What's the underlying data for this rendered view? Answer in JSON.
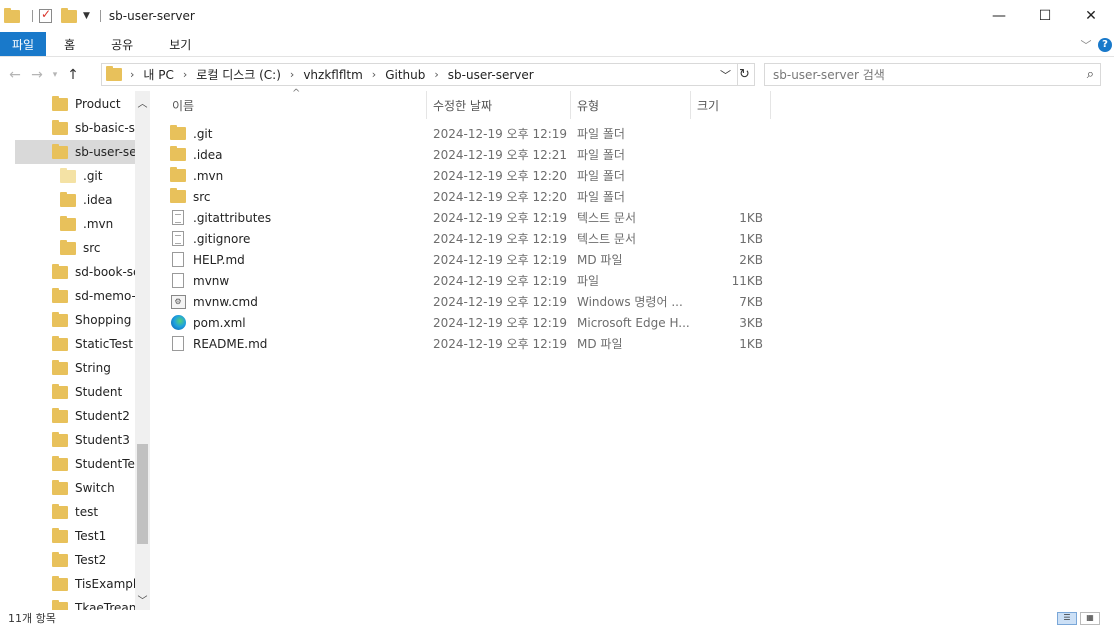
{
  "titlebar": {
    "title": "sb-user-server",
    "minimize_glyph": "—",
    "maximize_glyph": "☐",
    "close_glyph": "✕"
  },
  "ribbon": {
    "tabs": [
      "파일",
      "홈",
      "공유",
      "보기"
    ],
    "help": "?"
  },
  "address": {
    "crumbs": [
      "내 PC",
      "로컬 디스크 (C:)",
      "vhzkflfltm",
      "Github",
      "sb-user-server"
    ],
    "search_placeholder": "sb-user-server 검색"
  },
  "navpane": {
    "items": [
      {
        "label": "Product",
        "indent": 0,
        "selected": false
      },
      {
        "label": "sb-basic-ser",
        "indent": 0,
        "selected": false
      },
      {
        "label": "sb-user-serv",
        "indent": 0,
        "selected": true
      },
      {
        "label": ".git",
        "indent": 1,
        "selected": false,
        "pale": true
      },
      {
        "label": ".idea",
        "indent": 1,
        "selected": false
      },
      {
        "label": ".mvn",
        "indent": 1,
        "selected": false
      },
      {
        "label": "src",
        "indent": 1,
        "selected": false
      },
      {
        "label": "sd-book-ser",
        "indent": 0,
        "selected": false
      },
      {
        "label": "sd-memo-s",
        "indent": 0,
        "selected": false
      },
      {
        "label": "Shopping",
        "indent": 0,
        "selected": false
      },
      {
        "label": "StaticTest",
        "indent": 0,
        "selected": false
      },
      {
        "label": "String",
        "indent": 0,
        "selected": false
      },
      {
        "label": "Student",
        "indent": 0,
        "selected": false
      },
      {
        "label": "Student2",
        "indent": 0,
        "selected": false
      },
      {
        "label": "Student3",
        "indent": 0,
        "selected": false
      },
      {
        "label": "StudentTest",
        "indent": 0,
        "selected": false
      },
      {
        "label": "Switch",
        "indent": 0,
        "selected": false
      },
      {
        "label": "test",
        "indent": 0,
        "selected": false
      },
      {
        "label": "Test1",
        "indent": 0,
        "selected": false
      },
      {
        "label": "Test2",
        "indent": 0,
        "selected": false
      },
      {
        "label": "TisExample",
        "indent": 0,
        "selected": false
      },
      {
        "label": "TkaeTreans",
        "indent": 0,
        "selected": false
      }
    ]
  },
  "columns": {
    "name": "이름",
    "date": "수정한 날짜",
    "type": "유형",
    "size": "크기"
  },
  "files": [
    {
      "name": ".git",
      "date": "2024-12-19 오후 12:19",
      "type": "파일 폴더",
      "size": "",
      "icon": "folder"
    },
    {
      "name": ".idea",
      "date": "2024-12-19 오후 12:21",
      "type": "파일 폴더",
      "size": "",
      "icon": "folder"
    },
    {
      "name": ".mvn",
      "date": "2024-12-19 오후 12:20",
      "type": "파일 폴더",
      "size": "",
      "icon": "folder"
    },
    {
      "name": "src",
      "date": "2024-12-19 오후 12:20",
      "type": "파일 폴더",
      "size": "",
      "icon": "folder"
    },
    {
      "name": ".gitattributes",
      "date": "2024-12-19 오후 12:19",
      "type": "텍스트 문서",
      "size": "1KB",
      "icon": "text"
    },
    {
      "name": ".gitignore",
      "date": "2024-12-19 오후 12:19",
      "type": "텍스트 문서",
      "size": "1KB",
      "icon": "text"
    },
    {
      "name": "HELP.md",
      "date": "2024-12-19 오후 12:19",
      "type": "MD 파일",
      "size": "2KB",
      "icon": "file"
    },
    {
      "name": "mvnw",
      "date": "2024-12-19 오후 12:19",
      "type": "파일",
      "size": "11KB",
      "icon": "file"
    },
    {
      "name": "mvnw.cmd",
      "date": "2024-12-19 오후 12:19",
      "type": "Windows 명령어 ...",
      "size": "7KB",
      "icon": "cmd"
    },
    {
      "name": "pom.xml",
      "date": "2024-12-19 오후 12:19",
      "type": "Microsoft Edge H...",
      "size": "3KB",
      "icon": "edge"
    },
    {
      "name": "README.md",
      "date": "2024-12-19 오후 12:19",
      "type": "MD 파일",
      "size": "1KB",
      "icon": "file"
    }
  ],
  "status": {
    "text": "11개 항목"
  }
}
